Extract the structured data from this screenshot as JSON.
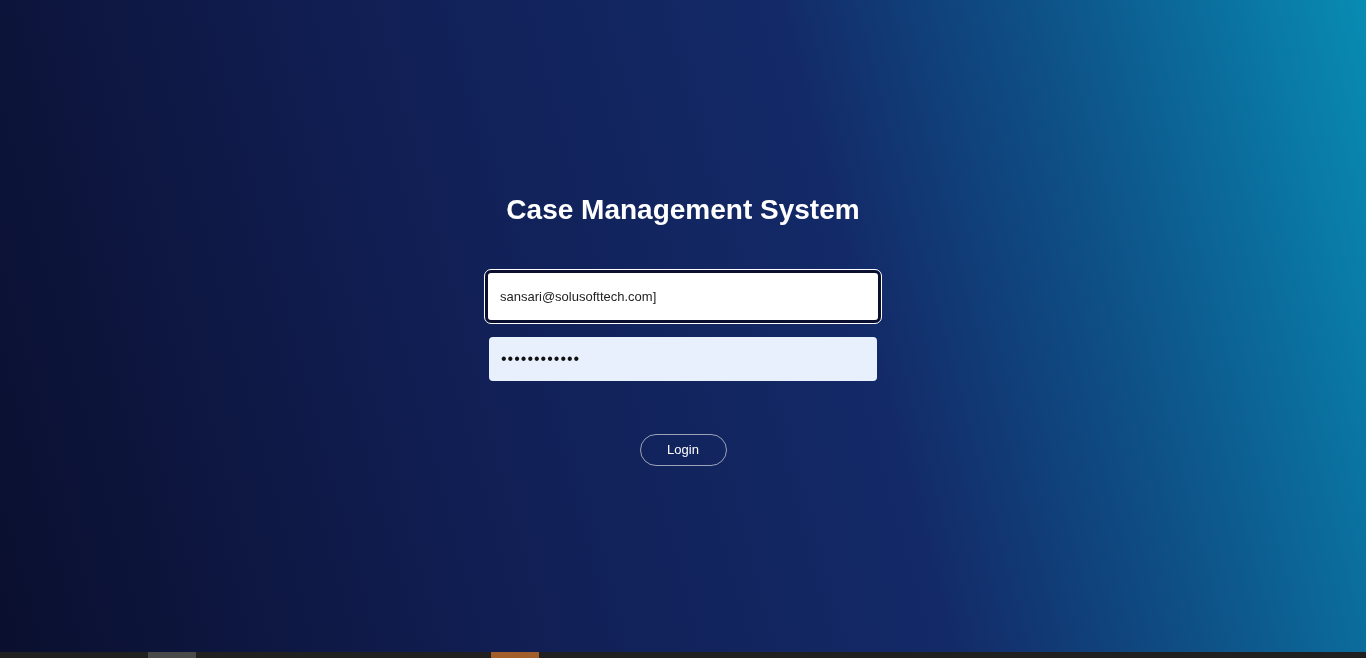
{
  "title": "Case Management System",
  "fields": [
    {
      "kind": "email",
      "value": "sansari@solusofttech.com]",
      "focused": true
    },
    {
      "kind": "password",
      "value": "••••••••••••",
      "focused": false
    }
  ],
  "login_button": {
    "label": "Login"
  }
}
